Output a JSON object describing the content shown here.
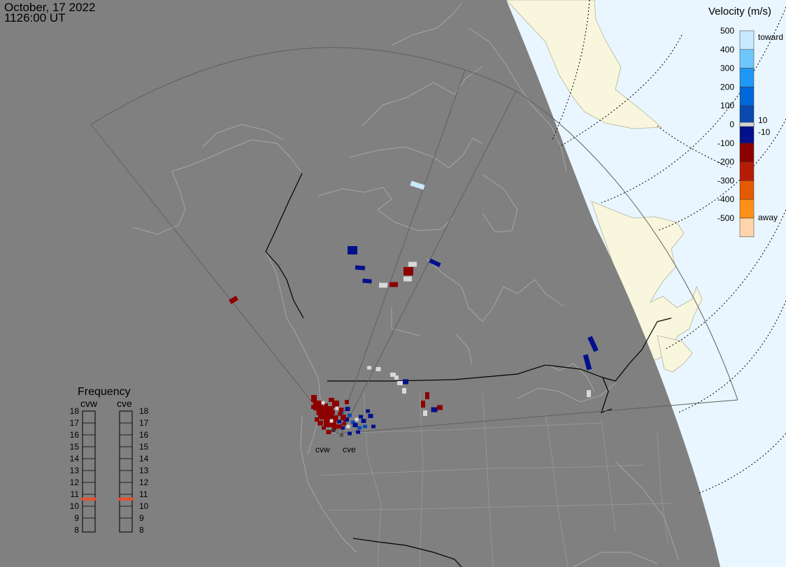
{
  "header": {
    "date": "October, 17 2022",
    "time": "1126:00 UT"
  },
  "colors": {
    "night_side": "#808080",
    "day_ocean": "#e9f6ff",
    "day_land": "#f8f6dc",
    "coast_lines": "#a6a6a6",
    "state_lines": "#9a9a9a",
    "border_lines": "#000000",
    "fov_outline": "#5f5f5f",
    "frequency_marker": "#e8502a"
  },
  "velocity_scale": {
    "title": "Velocity (m/s)",
    "ticks": [
      "500",
      "400",
      "300",
      "200",
      "100",
      "0",
      "-100",
      "-200",
      "-300",
      "-400",
      "-500"
    ],
    "toward_label": "toward",
    "away_label": "away",
    "inner_pos_label": "10",
    "inner_neg_label": "-10",
    "colors": [
      "#c9e9ff",
      "#6ec7fc",
      "#1e97f5",
      "#0068d8",
      "#0b49b0",
      "#03108b",
      "#8c0000",
      "#b51c07",
      "#e55a00",
      "#ff8f16",
      "#ffd4ab"
    ]
  },
  "frequency_panel": {
    "title": "Frequency",
    "radars": [
      "cvw",
      "cve"
    ],
    "levels": [
      "18",
      "17",
      "16",
      "15",
      "14",
      "13",
      "12",
      "11",
      "10",
      "9",
      "8"
    ],
    "active_mhz": [
      10.6,
      10.6
    ]
  },
  "radar_sites": [
    {
      "code": "cvw",
      "label": "cvw"
    },
    {
      "code": "cve",
      "label": "cve"
    }
  ],
  "echoes": [
    {
      "color": "blue",
      "count": 5
    },
    {
      "color": "navy",
      "count": 20
    },
    {
      "color": "red",
      "count": 30
    },
    {
      "color": "white",
      "count": 16
    },
    {
      "color": "lightblue",
      "count": 1
    }
  ]
}
